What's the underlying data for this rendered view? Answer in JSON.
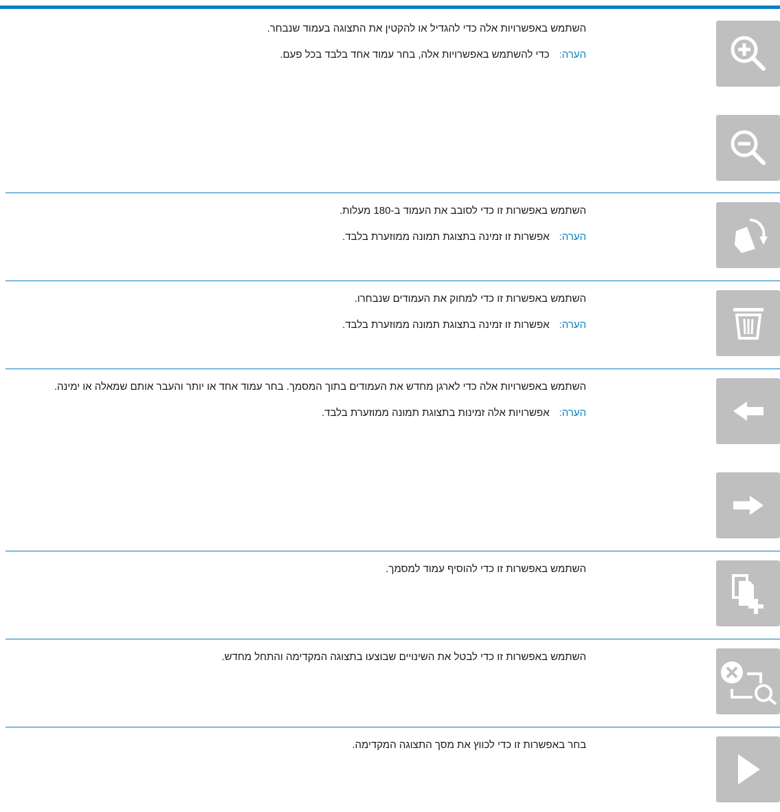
{
  "accent_color": "#0e7fc0",
  "button_color": "#bfbfbf",
  "rows": [
    {
      "description": "השתמש באפשרויות אלה כדי להגדיל או להקטין את התצוגה בעמוד שנבחר.",
      "note_label": "הערה:",
      "note_text": "כדי להשתמש באפשרויות אלה, בחר עמוד אחד בלבד בכל פעם.",
      "icons": [
        "zoom-in-icon",
        "zoom-out-icon"
      ]
    },
    {
      "description": "השתמש באפשרות זו כדי לסובב את העמוד ב-180 מעלות.",
      "note_label": "הערה:",
      "note_text": "אפשרות זו זמינה בתצוגת תמונה ממוזערת בלבד.",
      "icons": [
        "rotate-page-icon"
      ]
    },
    {
      "description": "השתמש באפשרות זו כדי למחוק את העמודים שנבחרו.",
      "note_label": "הערה:",
      "note_text": "אפשרות זו זמינה בתצוגת תמונה ממוזערת בלבד.",
      "icons": [
        "trash-icon"
      ]
    },
    {
      "description": "השתמש באפשרויות אלה כדי לארגן מחדש את העמודים בתוך המסמך. בחר עמוד אחד או יותר והעבר אותם שמאלה או ימינה.",
      "note_label": "הערה:",
      "note_text": "אפשרויות אלה זמינות בתצוגת תמונה ממוזערת בלבד.",
      "icons": [
        "arrow-left-icon",
        "arrow-right-icon"
      ]
    },
    {
      "description": "השתמש באפשרות זו כדי להוסיף עמוד למסמך.",
      "icons": [
        "add-page-icon"
      ]
    },
    {
      "description": "השתמש באפשרות זו כדי לבטל את השינויים שבוצעו בתצוגה המקדימה והתחל מחדש.",
      "icons": [
        "reset-preview-icon"
      ]
    },
    {
      "description": "בחר באפשרות זו כדי לכווץ את מסך התצוגה המקדימה.",
      "icons": [
        "collapse-preview-icon"
      ]
    }
  ]
}
